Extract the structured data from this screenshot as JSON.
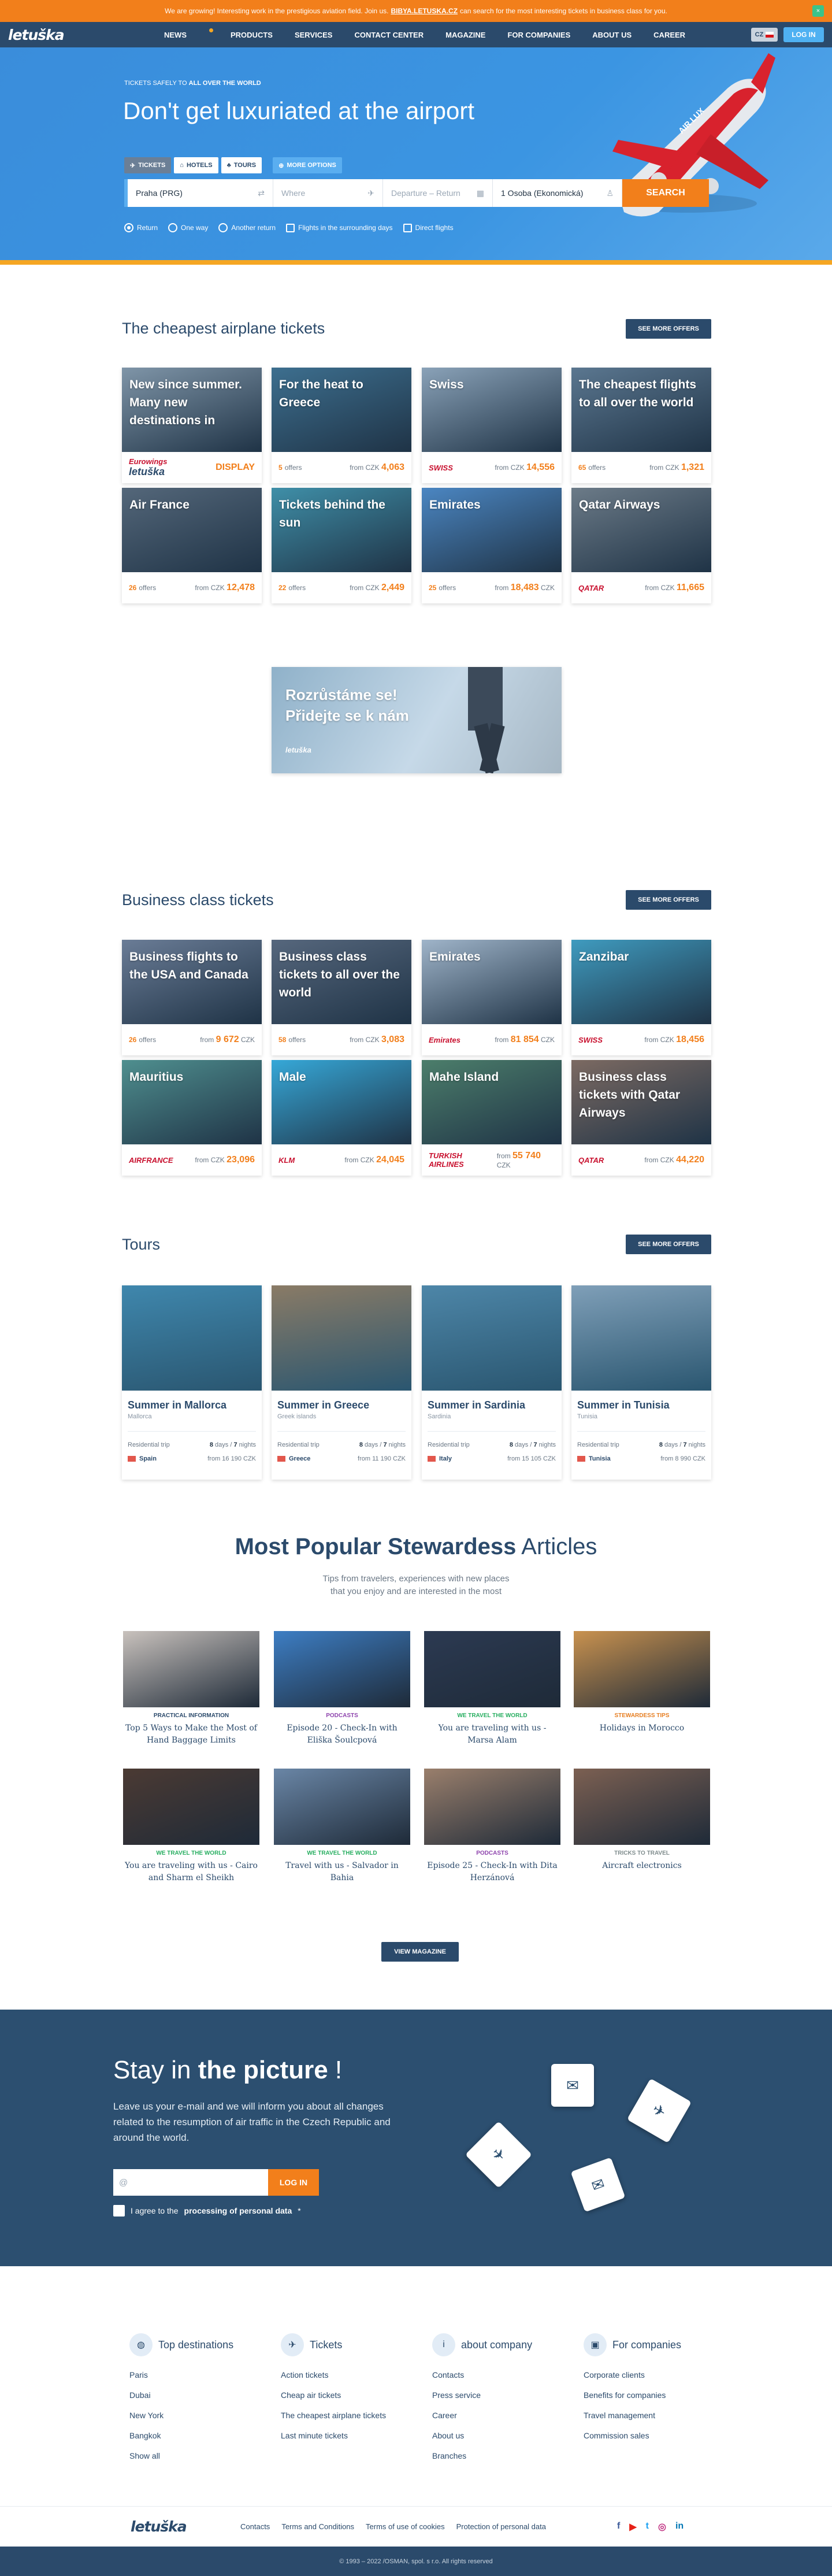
{
  "topbar": {
    "text_a": "We are growing! Interesting work in the prestigious aviation field. Join us.",
    "text_b": "BIBYA.LETUSKA.CZ",
    "text_c": "can search for the most interesting tickets in business class for you.",
    "close": "×"
  },
  "nav": {
    "logo": "letuška",
    "items": [
      "News",
      "Products",
      "Services",
      "Contact center",
      "Magazine",
      "For companies",
      "About us",
      "Career"
    ],
    "lang": "CZ",
    "login": "LOG IN"
  },
  "hero": {
    "tagline_a": "TICKETS SAFELY TO",
    "tagline_b": "ALL OVER THE WORLD",
    "heading": "Don't get luxuriated at the airport",
    "tabs": [
      "TICKETS",
      "HOTELS",
      "TOURS"
    ],
    "more_options": "MORE OPTIONS",
    "from": "Praha (PRG)",
    "where_placeholder": "Where",
    "dates_placeholder": "Departure – Return",
    "pax": "1 Osoba (Ekonomická)",
    "search": "SEARCH",
    "options": [
      "Return",
      "One way",
      "Another return",
      "Flights in the surrounding days",
      "Direct flights"
    ]
  },
  "cheapest": {
    "title": "The cheapest airplane tickets",
    "more": "SEE MORE OFFERS",
    "cards": [
      {
        "title": "New since summer. Many new destinations in",
        "logo": "Eurowings",
        "sub": "letuška",
        "right": "DISPLAY",
        "img": "#7f95a8"
      },
      {
        "title": "For the heat to Greece",
        "count": "5",
        "count_label": "offers",
        "from": "from CZK",
        "price": "4,063",
        "img": "#3d6f8f"
      },
      {
        "title": "Swiss",
        "logo": "SWISS",
        "from": "from CZK",
        "price": "14,556",
        "img": "#8aa2b8"
      },
      {
        "title": "The cheapest flights to all over the world",
        "count": "65",
        "count_label": "offers",
        "from": "from CZK",
        "price": "1,321",
        "img": "#5b7790"
      },
      {
        "title": "Air France",
        "count": "26",
        "count_label": "offers",
        "from": "from CZK",
        "price": "12,478",
        "img": "#54677a"
      },
      {
        "title": "Tickets behind the sun",
        "count": "22",
        "count_label": "offers",
        "from": "from CZK",
        "price": "2,449",
        "img": "#3f8fa8"
      },
      {
        "title": "Emirates",
        "count": "25",
        "count_label": "offers",
        "from": "from",
        "price": "18,483",
        "cur": "CZK",
        "img": "#4b86c2"
      },
      {
        "title": "Qatar Airways",
        "logo": "QATAR",
        "from": "from CZK",
        "price": "11,665",
        "img": "#6c7b88"
      }
    ]
  },
  "banner": {
    "line1": "Rozrůstáme se!",
    "line2": "Přidejte se k nám",
    "logo": "letuška"
  },
  "business": {
    "title": "Business class tickets",
    "more": "SEE MORE OFFERS",
    "cards": [
      {
        "title": "Business flights to the USA and Canada",
        "count": "26",
        "count_label": "offers",
        "from": "from",
        "price": "9 672",
        "cur": "CZK",
        "img": "#6a7c96"
      },
      {
        "title": "Business class tickets to all over the world",
        "count": "58",
        "count_label": "offers",
        "from": "from CZK",
        "price": "3,083",
        "img": "#56677d"
      },
      {
        "title": "Emirates",
        "logo": "Emirates",
        "from": "from",
        "price": "81 854",
        "cur": "CZK",
        "img": "#9fb4c9"
      },
      {
        "title": "Zanzibar",
        "logo": "SWISS",
        "from": "from CZK",
        "price": "18,456",
        "img": "#3f9bbf"
      },
      {
        "title": "Mauritius",
        "logo": "AIRFRANCE",
        "from": "from CZK",
        "price": "23,096",
        "img": "#4f8f8f"
      },
      {
        "title": "Male",
        "logo": "KLM",
        "from": "from CZK",
        "price": "24,045",
        "img": "#36a8d8"
      },
      {
        "title": "Mahe Island",
        "logo": "TURKISH AIRLINES",
        "from": "from",
        "price": "55 740",
        "cur": "CZK",
        "img": "#4c7e6b"
      },
      {
        "title": "Business class tickets with Qatar Airways",
        "logo": "QATAR",
        "from": "from CZK",
        "price": "44,220",
        "img": "#7c6a62"
      }
    ]
  },
  "tours": {
    "title": "Tours",
    "more": "SEE MORE OFFERS",
    "cards": [
      {
        "name": "Summer in Mallorca",
        "sub": "Mallorca",
        "type": "Residential trip",
        "days": "8",
        "nights": "7",
        "country": "Spain",
        "from": "from",
        "price": "16 190 CZK",
        "img": "#3f87ad"
      },
      {
        "name": "Summer in Greece",
        "sub": "Greek islands",
        "type": "Residential trip",
        "days": "8",
        "nights": "7",
        "country": "Greece",
        "from": "from",
        "price": "11 190 CZK",
        "img": "#8a7b66"
      },
      {
        "name": "Summer in Sardinia",
        "sub": "Sardinia",
        "type": "Residential trip",
        "days": "8",
        "nights": "7",
        "country": "Italy",
        "from": "from",
        "price": "15 105 CZK",
        "img": "#4d86a8"
      },
      {
        "name": "Summer in Tunisia",
        "sub": "Tunisia",
        "type": "Residential trip",
        "days": "8",
        "nights": "7",
        "country": "Tunisia",
        "from": "from",
        "price": "8 990 CZK",
        "img": "#7f9fb8"
      }
    ],
    "days_label": "days",
    "nights_label": "nights"
  },
  "magazine": {
    "title_a": "Most Popular Stewardess",
    "title_b": "Articles",
    "sub1": "Tips from travelers, experiences with new places",
    "sub2": "that you enjoy and are interested in the most",
    "articles": [
      {
        "cat": "PRACTICAL INFORMATION",
        "cat_color": "#2b4a6b",
        "title": "Top 5 Ways to Make the Most of Hand Baggage Limits",
        "img": "#c9c2bd"
      },
      {
        "cat": "PODCASTS",
        "cat_color": "#8e44ad",
        "title": "Episode 20 - Check-In with Eliška Šoulcpová",
        "img": "#3d7ec4"
      },
      {
        "cat": "WE TRAVEL THE WORLD",
        "cat_color": "#27ae60",
        "title": "You are traveling with us - Marsa Alam",
        "img": "#2c3a52"
      },
      {
        "cat": "STEWARDESS TIPS",
        "cat_color": "#e67e22",
        "title": "Holidays in Morocco",
        "img": "#c9924f"
      },
      {
        "cat": "WE TRAVEL THE WORLD",
        "cat_color": "#27ae60",
        "title": "You are traveling with us - Cairo and Sharm el Sheikh",
        "img": "#4b3a33"
      },
      {
        "cat": "WE TRAVEL THE WORLD",
        "cat_color": "#27ae60",
        "title": "Travel with us - Salvador in Bahia",
        "img": "#6a86a6"
      },
      {
        "cat": "PODCASTS",
        "cat_color": "#8e44ad",
        "title": "Episode 25 - Check-In with Dita Herzánová",
        "img": "#9a7f6c"
      },
      {
        "cat": "TRICKS TO TRAVEL",
        "cat_color": "#7f8c8d",
        "title": "Aircraft electronics",
        "img": "#7c6052"
      }
    ],
    "view": "VIEW MAGAZINE"
  },
  "newsletter": {
    "title_a": "Stay in",
    "title_b": "the picture",
    "title_c": " !",
    "text": "Leave us your e-mail and we will inform you about all changes related to the resumption of air traffic in the Czech Republic and around the world.",
    "placeholder": "@",
    "button": "LOG IN",
    "agree_a": "I agree to the",
    "agree_b": "processing of personal data",
    "agree_star": "*"
  },
  "footer": {
    "cols": [
      {
        "title": "Top destinations",
        "icon": "globe-icon",
        "items": [
          "Paris",
          "Dubai",
          "New York",
          "Bangkok",
          "Show all"
        ]
      },
      {
        "title": "Tickets",
        "icon": "plane-icon",
        "items": [
          "Action tickets",
          "Cheap air tickets",
          "The cheapest airplane tickets",
          "Last minute tickets"
        ]
      },
      {
        "title": "about company",
        "icon": "info-icon",
        "items": [
          "Contacts",
          "Press service",
          "Career",
          "About us",
          "Branches"
        ]
      },
      {
        "title": "For companies",
        "icon": "briefcase-icon",
        "items": [
          "Corporate clients",
          "Benefits for companies",
          "Travel management",
          "Commission sales"
        ]
      }
    ],
    "logo": "letuška",
    "links": [
      "Contacts",
      "Terms and Conditions",
      "Terms of use of cookies",
      "Protection of personal data"
    ],
    "social": [
      "f",
      "▶",
      "t",
      "◎",
      "in"
    ],
    "social_colors": [
      "#3b5998",
      "#e62117",
      "#1da1f2",
      "#c13584",
      "#0077b5"
    ],
    "copyright": "© 1993 – 2022 /OSMAN, spol. s r.o. All rights reserved"
  },
  "colors": {
    "orange": "#f27f1b",
    "navy": "#2b4a6b",
    "blue": "#3b95e2"
  }
}
